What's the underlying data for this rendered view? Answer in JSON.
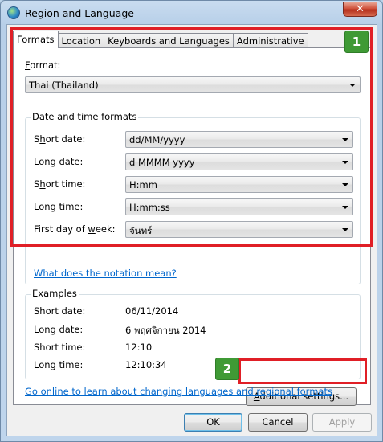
{
  "window": {
    "title": "Region and Language",
    "close_glyph": "✕"
  },
  "tabs": [
    {
      "label": "Formats",
      "active": true
    },
    {
      "label": "Location"
    },
    {
      "label": "Keyboards and Languages"
    },
    {
      "label": "Administrative"
    }
  ],
  "format": {
    "label_first": "F",
    "label_rest": "ormat:",
    "value": "Thai (Thailand)"
  },
  "datetime": {
    "group_title": "Date and time formats",
    "rows": [
      {
        "pre": "S",
        "ul": "h",
        "post": "ort date:",
        "value": "dd/MM/yyyy"
      },
      {
        "pre": "L",
        "ul": "o",
        "post": "ng date:",
        "value": "d MMMM yyyy"
      },
      {
        "pre": "S",
        "ul": "h",
        "post": "ort time:",
        "value": "H:mm"
      },
      {
        "pre": "Lo",
        "ul": "n",
        "post": "g time:",
        "value": "H:mm:ss"
      },
      {
        "pre": "First day of ",
        "ul": "w",
        "post": "eek:",
        "value": "จันทร์"
      }
    ],
    "notation_link": "What does the notation mean?"
  },
  "examples": {
    "group_title": "Examples",
    "rows": [
      {
        "label": "Short date:",
        "value": "06/11/2014"
      },
      {
        "label": "Long date:",
        "value": "6 พฤศจิกายน 2014"
      },
      {
        "label": "Short time:",
        "value": "12:10"
      },
      {
        "label": "Long time:",
        "value": "12:10:34"
      }
    ]
  },
  "additional_button": {
    "ul": "A",
    "rest": "dditional settings..."
  },
  "online_link": "Go online to learn about changing languages and regional formats",
  "footer": {
    "ok": "OK",
    "cancel": "Cancel",
    "apply": "Apply"
  },
  "callouts": {
    "one": "1",
    "two": "2"
  },
  "colors": {
    "callout_border": "#e01f26",
    "badge_bg": "#3f9a35",
    "link": "#0066cc"
  }
}
